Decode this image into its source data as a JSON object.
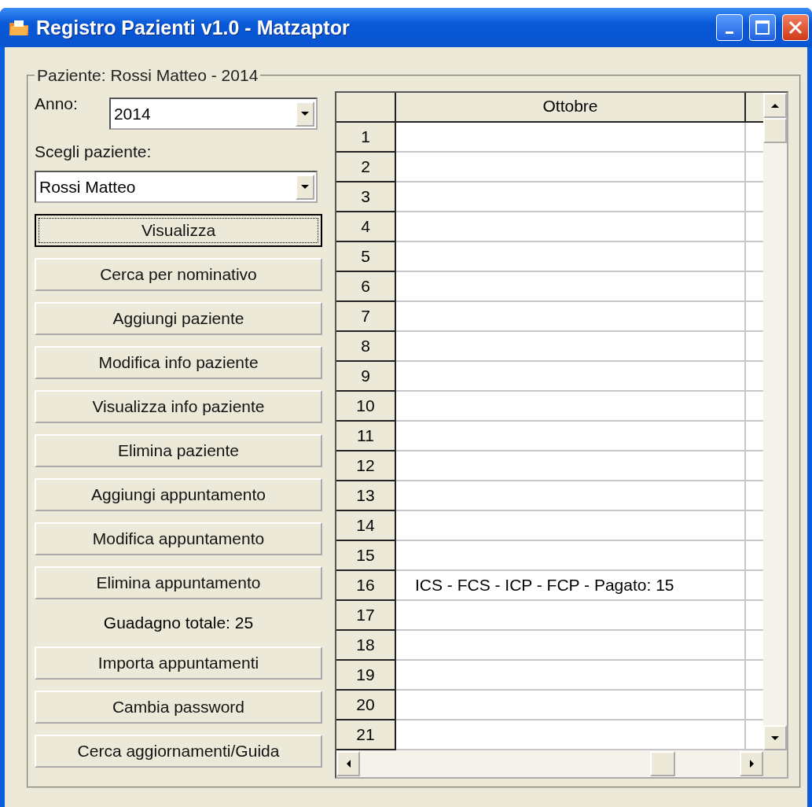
{
  "window": {
    "title": "Registro Pazienti v1.0 - Matzaptor"
  },
  "group": {
    "title": "Paziente: Rossi Matteo - 2014"
  },
  "year": {
    "label": "Anno:",
    "value": "2014"
  },
  "patient": {
    "label": "Scegli paziente:",
    "value": "Rossi Matteo"
  },
  "buttons": [
    {
      "label": "Visualizza",
      "focused": true
    },
    {
      "label": "Cerca per nominativo",
      "focused": false
    },
    {
      "label": "Aggiungi paziente",
      "focused": false
    },
    {
      "label": "Modifica info paziente",
      "focused": false
    },
    {
      "label": "Visualizza info paziente",
      "focused": false
    },
    {
      "label": "Elimina paziente",
      "focused": false
    },
    {
      "label": "Aggiungi appuntamento",
      "focused": false
    },
    {
      "label": "Modifica appuntamento",
      "focused": false
    },
    {
      "label": "Elimina appuntamento",
      "focused": false
    }
  ],
  "total": "Guadagno totale: 25",
  "buttons_bottom": [
    {
      "label": "Importa appuntamenti",
      "focused": false
    },
    {
      "label": "Cambia password",
      "focused": false
    },
    {
      "label": "Cerca aggiornamenti/Guida",
      "focused": false
    }
  ],
  "table": {
    "columns": [
      "Ottobre"
    ],
    "rows": [
      {
        "number": "1",
        "cell": ""
      },
      {
        "number": "2",
        "cell": ""
      },
      {
        "number": "3",
        "cell": ""
      },
      {
        "number": "4",
        "cell": ""
      },
      {
        "number": "5",
        "cell": ""
      },
      {
        "number": "6",
        "cell": ""
      },
      {
        "number": "7",
        "cell": ""
      },
      {
        "number": "8",
        "cell": ""
      },
      {
        "number": "9",
        "cell": ""
      },
      {
        "number": "10",
        "cell": ""
      },
      {
        "number": "11",
        "cell": ""
      },
      {
        "number": "12",
        "cell": ""
      },
      {
        "number": "13",
        "cell": ""
      },
      {
        "number": "14",
        "cell": ""
      },
      {
        "number": "15",
        "cell": ""
      },
      {
        "number": "16",
        "cell": "ICS - FCS - ICP - FCP - Pagato: 15"
      },
      {
        "number": "17",
        "cell": ""
      },
      {
        "number": "18",
        "cell": ""
      },
      {
        "number": "19",
        "cell": ""
      },
      {
        "number": "20",
        "cell": ""
      },
      {
        "number": "21",
        "cell": ""
      }
    ]
  }
}
